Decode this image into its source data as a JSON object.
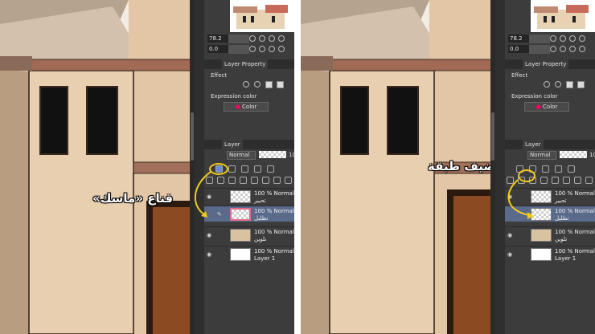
{
  "panels": [
    {
      "annotation": "قناع «ماسك»",
      "ui": {
        "zoom": "78.2",
        "angle": "0.0",
        "tab_layer_property": "Layer Property",
        "effect_label": "Effect",
        "expression_color_label": "Expression color",
        "color_dropdown": "Color",
        "layer_tab": "Layer",
        "blend_mode": "Normal",
        "opacity_edge": "10",
        "layers": [
          {
            "line1": "100 % Normal",
            "line2": "تحبير"
          },
          {
            "line1": "100 % Normal",
            "line2": "تظليل"
          },
          {
            "line1": "100 % Normal",
            "line2": "تلوين"
          },
          {
            "line1": "100 % Normal",
            "line2": "Layer 1"
          }
        ]
      }
    },
    {
      "annotation": "نضيف طبقة",
      "ui": {
        "zoom": "78.2",
        "angle": "0.0",
        "tab_layer_property": "Layer Property",
        "effect_label": "Effect",
        "expression_color_label": "Expression color",
        "color_dropdown": "Color",
        "layer_tab": "Layer",
        "blend_mode": "Normal",
        "opacity_edge": "10",
        "layers": [
          {
            "line1": "100 % Normal",
            "line2": "تحبير"
          },
          {
            "line1": "100 % Normal",
            "line2": "تظليل"
          },
          {
            "line1": "100 % Normal",
            "line2": "تلوين"
          },
          {
            "line1": "100 % Normal",
            "line2": "Layer 1"
          }
        ]
      }
    }
  ],
  "colors": {
    "annotation_ring": "#f2cc1a",
    "wall": "#e7cfb0",
    "wall_shadow": "#b89d81",
    "roof": "#8a6a58",
    "door": "#8b4a22",
    "selected_layer": "#5a6a8a"
  },
  "icons": [
    "eye-icon",
    "pen-icon",
    "new-layer-icon",
    "mask-icon",
    "color-wheel-icon"
  ]
}
